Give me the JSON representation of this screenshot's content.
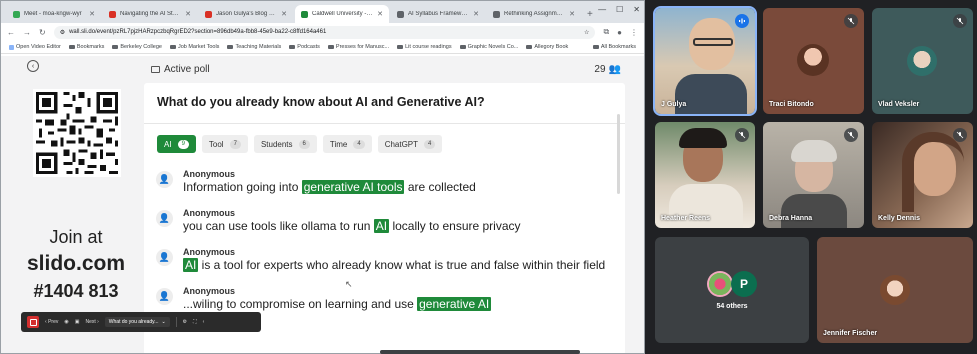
{
  "browser": {
    "tabs": [
      {
        "title": "Meet - moa-kngw-wyr",
        "color": "#34a853",
        "active": false
      },
      {
        "title": "Navigating the AI Storm | Co",
        "color": "#d93025",
        "active": false
      },
      {
        "title": "Jason Gulya's Blog Card",
        "color": "#d93025",
        "active": false
      },
      {
        "title": "Caldwell University -- What d",
        "color": "#1f8a3a",
        "active": true
      },
      {
        "title": "AI Syllabus Frameworks and",
        "color": "#5f6368",
        "active": false
      },
      {
        "title": "Rethinking Assignments for t",
        "color": "#5f6368",
        "active": false
      }
    ],
    "url": "wall.sli.do/event/pzRL7pjzHARzpczbqRgrED2?section=896db49a-fbb8-45e9-ba22-c8ffd164a461",
    "bookmarks": [
      "Open Video Editor",
      "Bookmarks",
      "Berkeley College",
      "Job Market Tools",
      "Teaching Materials",
      "Podcasts",
      "Presses for Manusc...",
      "Lit course readings",
      "Graphic Novels Co...",
      "Allegory Book"
    ],
    "bookmarks_right": "All Bookmarks"
  },
  "slido": {
    "poll_label": "Active poll",
    "participant_count": "29",
    "join": {
      "line1": "Join at",
      "domain": "slido.com",
      "code": "#1404 813"
    },
    "question": "What do you already know about AI and Generative AI?",
    "chips": [
      {
        "label": "AI",
        "count": "9",
        "active": true
      },
      {
        "label": "Tool",
        "count": "7",
        "active": false
      },
      {
        "label": "Students",
        "count": "6",
        "active": false
      },
      {
        "label": "Time",
        "count": "4",
        "active": false
      },
      {
        "label": "ChatGPT",
        "count": "4",
        "active": false
      }
    ],
    "responses": [
      {
        "name": "Anonymous",
        "before": "Information going into ",
        "highlight": "generative AI tools",
        "after": " are collected"
      },
      {
        "name": "Anonymous",
        "before": "you can use tools like ollama to run ",
        "highlight": "AI",
        "after": " locally to ensure privacy"
      },
      {
        "name": "Anonymous",
        "before": "",
        "highlight": "AI",
        "after": " is a tool for experts who already know what is true and false within their field"
      },
      {
        "name": "Anonymous",
        "before": "...wiling to compromise on learning and use ",
        "highlight": "generative AI",
        "after": ""
      }
    ]
  },
  "toolbar": {
    "prev": "Prev",
    "next": "Next",
    "current": "What do you already..."
  },
  "meet": {
    "participants": [
      {
        "name": "J Gulya",
        "muted": false,
        "speaking": true
      },
      {
        "name": "Traci Bitondo",
        "muted": true
      },
      {
        "name": "Vlad Veksler",
        "muted": true
      },
      {
        "name": "Heather Reens",
        "muted": true
      },
      {
        "name": "Debra Hanna",
        "muted": true
      },
      {
        "name": "Kelly Dennis",
        "muted": true
      },
      {
        "name": "Jennifer Fischer",
        "muted": true
      }
    ],
    "others_label": "54 others",
    "others_initial": "P"
  }
}
